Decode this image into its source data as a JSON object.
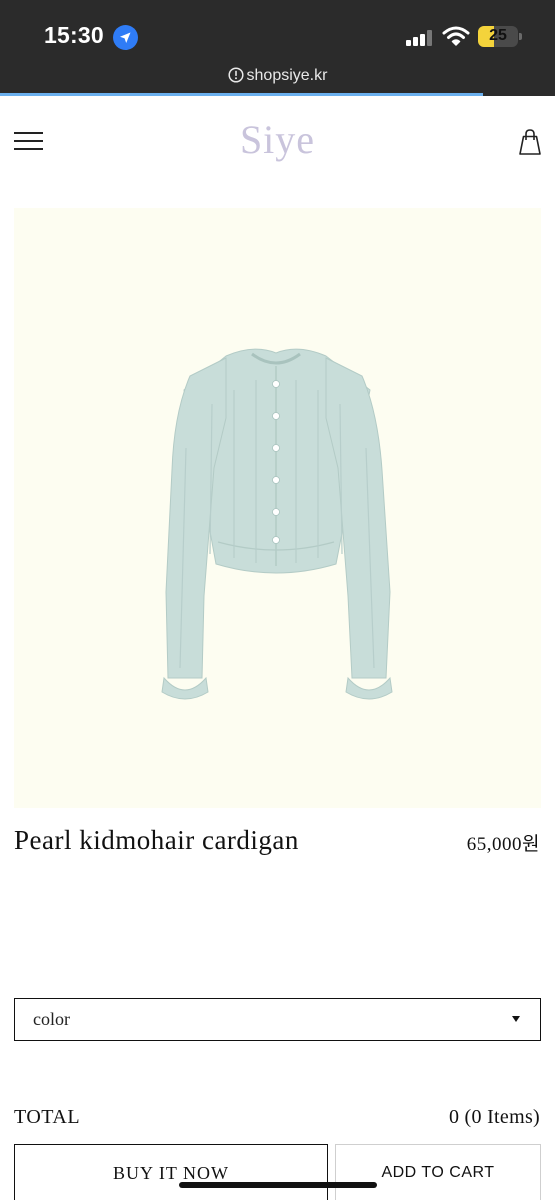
{
  "status_bar": {
    "time": "15:30",
    "battery_level": "25",
    "battery_fraction": 0.25
  },
  "browser": {
    "url": "shopsiye.kr",
    "load_progress": 0.87
  },
  "header": {
    "logo_text": "Siye",
    "logo_color": "#c9c4dc"
  },
  "product": {
    "name": "Pearl kidmohair cardigan",
    "price": "65,000원",
    "image_background": "#fdfdf1",
    "garment_color": "#c8ddd9"
  },
  "options": {
    "color_select_value": "color"
  },
  "summary": {
    "total_label": "TOTAL",
    "total_value": "0 (0 Items)"
  },
  "actions": {
    "buy_now_label": "BUY IT NOW",
    "add_to_cart_label": "ADD TO CART"
  },
  "icons": {
    "location": "location-arrow-icon",
    "signal": "cellular-signal-icon",
    "wifi": "wifi-icon",
    "battery": "battery-icon",
    "site_info": "info-circle-icon",
    "menu": "hamburger-menu-icon",
    "cart": "shopping-bag-icon",
    "select_caret": "caret-down-icon"
  }
}
